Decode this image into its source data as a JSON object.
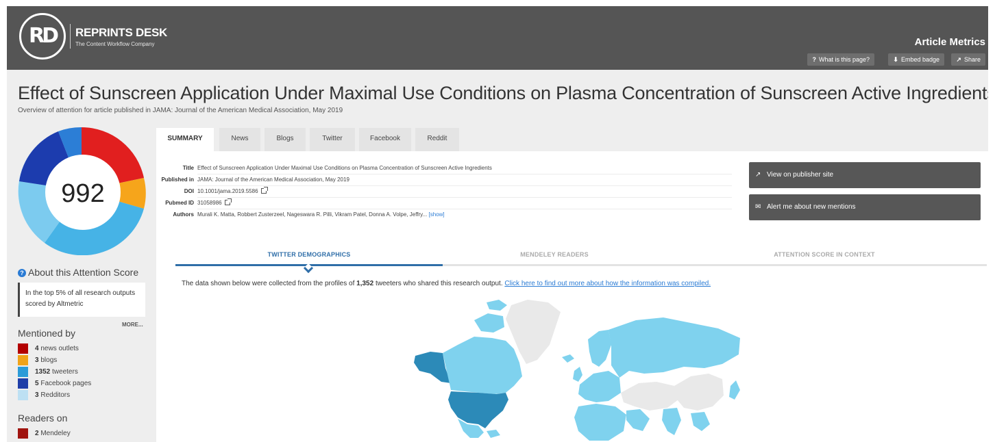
{
  "header": {
    "logo_mark": "RD",
    "brand": "REPRINTS DESK",
    "tagline": "The Content Workflow Company",
    "page_title": "Article Metrics",
    "buttons": [
      {
        "icon": "?",
        "label": "What is this page?"
      },
      {
        "icon": "⬇",
        "label": "Embed badge"
      },
      {
        "icon": "↗",
        "label": "Share"
      }
    ]
  },
  "article": {
    "title": "Effect of Sunscreen Application Under Maximal Use Conditions on Plasma Concentration of Sunscreen Active Ingredients",
    "subtitle": "Overview of attention for article published in JAMA: Journal of the American Medical Association, May 2019"
  },
  "score": {
    "value": "992",
    "colors": [
      "#e11f1f",
      "#f6a51b",
      "#46b3e6",
      "#1c3cae",
      "#d6ecf7"
    ]
  },
  "sidebar": {
    "about_title": "About this Attention Score",
    "about_text": "In the top 5% of all research outputs scored by Altmetric",
    "more_label": "MORE...",
    "mentioned_title": "Mentioned by",
    "mentions": [
      {
        "count": "4",
        "label": "news outlets",
        "color": "#b30000"
      },
      {
        "count": "3",
        "label": "blogs",
        "color": "#f0a319"
      },
      {
        "count": "1352",
        "label": "tweeters",
        "color": "#2b9bd8"
      },
      {
        "count": "5",
        "label": "Facebook pages",
        "color": "#1f3ea8"
      },
      {
        "count": "3",
        "label": "Redditors",
        "color": "#bde0f3"
      }
    ],
    "readers_title": "Readers on",
    "readers": [
      {
        "count": "2",
        "label": "Mendeley",
        "color": "#a0140f"
      }
    ]
  },
  "tabs": [
    "SUMMARY",
    "News",
    "Blogs",
    "Twitter",
    "Facebook",
    "Reddit"
  ],
  "details": {
    "rows": [
      {
        "key": "Title",
        "value": "Effect of Sunscreen Application Under Maximal Use Conditions on Plasma Concentration of Sunscreen Active Ingredients"
      },
      {
        "key": "Published in",
        "value": "JAMA: Journal of the American Medical Association, May 2019"
      },
      {
        "key": "DOI",
        "value": "10.1001/jama.2019.5586"
      },
      {
        "key": "Pubmed ID",
        "value": "31058986"
      },
      {
        "key": "Authors",
        "value": "Murali K. Matta, Robbert Zusterzeel, Nageswara R. Pilli, Vikram Patel, Donna A. Volpe, Jeffry...",
        "link": "[show]"
      }
    ]
  },
  "actions": [
    {
      "icon": "↗",
      "label": "View on publisher site"
    },
    {
      "icon": "✉",
      "label": "Alert me about new mentions"
    }
  ],
  "demo_tabs": [
    "TWITTER DEMOGRAPHICS",
    "MENDELEY READERS",
    "ATTENTION SCORE IN CONTEXT"
  ],
  "note": {
    "prefix": "The data shown below were collected from the profiles of",
    "count": "1,352",
    "suffix": "tweeters who shared this research output.",
    "link": "Click here to find out more about how the information was compiled."
  },
  "map_colors": {
    "high": "#2c8ab8",
    "mid": "#7fd2ee",
    "low": "#9ce4f7",
    "none": "#e9e9e9"
  }
}
